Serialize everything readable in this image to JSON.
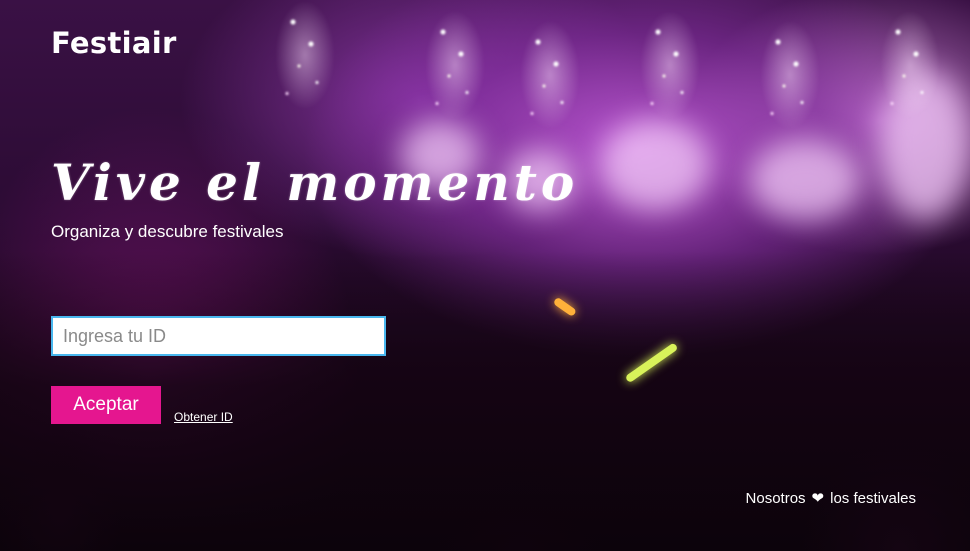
{
  "brand": {
    "name": "Festiair"
  },
  "hero": {
    "title": "Vive el momento",
    "subtitle": "Organiza y descubre festivales"
  },
  "login": {
    "id_placeholder": "Ingresa tu ID",
    "id_value": "",
    "accept_label": "Aceptar",
    "get_id_label": "Obtener ID"
  },
  "footer": {
    "prefix": "Nosotros",
    "icon": "heart-icon",
    "suffix": "los festivales"
  },
  "colors": {
    "accent": "#e5168f",
    "input_border": "#49b7ee"
  }
}
